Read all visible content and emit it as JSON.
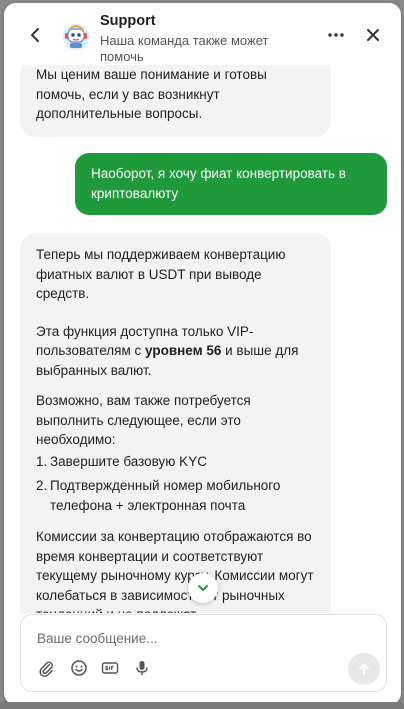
{
  "header": {
    "title": "Support",
    "subtitle": "Наша команда также может помочь"
  },
  "messages": {
    "first_incoming": "Мы ценим ваше понимание и готовы помочь, если у вас возникнут дополнительные вопросы.",
    "outgoing": "Наоборот, я хочу фиат конвертировать в криптовалюту",
    "second_incoming": {
      "p1": "Теперь мы поддерживаем конвертацию фиатных валют в USDT при выводе средств.",
      "p2_pre": "Эта функция доступна только VIP-пользователям с ",
      "p2_bold": "уровнем 56",
      "p2_post": " и выше для выбранных валют.",
      "p3": "Возможно, вам также потребуется выполнить следующее, если это необходимо:",
      "list": [
        {
          "num": "1.",
          "text": "Завершите базовую KYC"
        },
        {
          "num": "2.",
          "text": "Подтвержденный номер мобильного телефона + электронная почта"
        }
      ],
      "p4": "Комиссии за конвертацию отображаются во время конвертации и соответствуют текущему рыночному курсу. Комиссии могут колебаться в зависимости от рыночных тенденций и не подлежат"
    }
  },
  "composer": {
    "placeholder": "Ваше сообщение..."
  },
  "icons": {
    "back": "chevron-left-icon",
    "more": "more-horizontal-icon",
    "close": "close-icon",
    "scroll": "chevron-down-icon",
    "attach": "paperclip-icon",
    "emoji": "smiley-icon",
    "gif": "gif-icon",
    "mic": "microphone-icon",
    "send": "arrow-up-icon"
  },
  "colors": {
    "outgoing_bubble": "#1e9a3b",
    "incoming_bubble": "#f3f3f3",
    "scroll_arrow": "#1e9a3b"
  }
}
